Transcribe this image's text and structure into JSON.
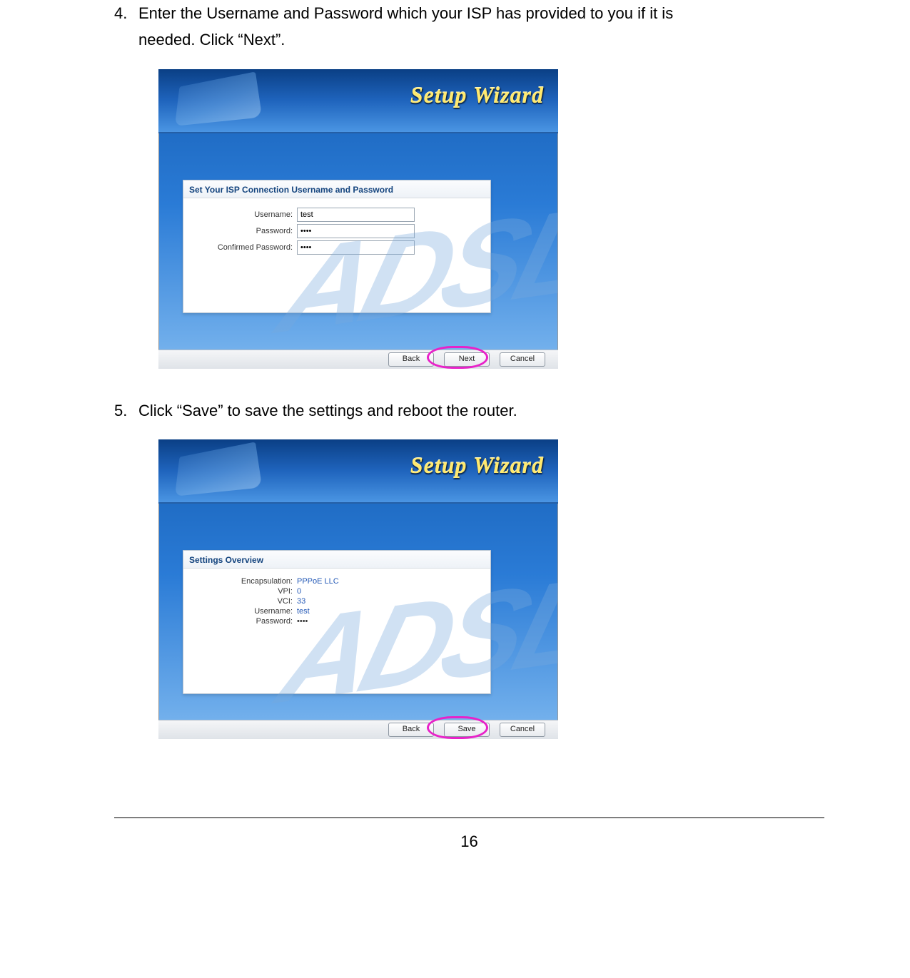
{
  "steps": {
    "s4": {
      "num": "4.",
      "text_line1": "Enter the Username and Password which your ISP has provided to you if it is",
      "text_line2": "needed. Click “Next”."
    },
    "s5": {
      "num": "5.",
      "text": "Click “Save” to save the settings and reboot the router."
    }
  },
  "wizard": {
    "title": "Setup Wizard",
    "shot1": {
      "panel_title": "Set Your ISP Connection Username and Password",
      "fields": {
        "username_label": "Username:",
        "username_value": "test",
        "password_label": "Password:",
        "password_value": "••••",
        "confirm_label": "Confirmed Password:",
        "confirm_value": "••••"
      },
      "buttons": {
        "back": "Back",
        "next": "Next",
        "cancel": "Cancel"
      }
    },
    "shot2": {
      "panel_title": "Settings Overview",
      "rows": {
        "encap_k": "Encapsulation:",
        "encap_v": "PPPoE LLC",
        "vpi_k": "VPI:",
        "vpi_v": "0",
        "vci_k": "VCI:",
        "vci_v": "33",
        "user_k": "Username:",
        "user_v": "test",
        "pass_k": "Password:",
        "pass_v": "••••"
      },
      "buttons": {
        "back": "Back",
        "save": "Save",
        "cancel": "Cancel"
      }
    }
  },
  "page_number": "16"
}
